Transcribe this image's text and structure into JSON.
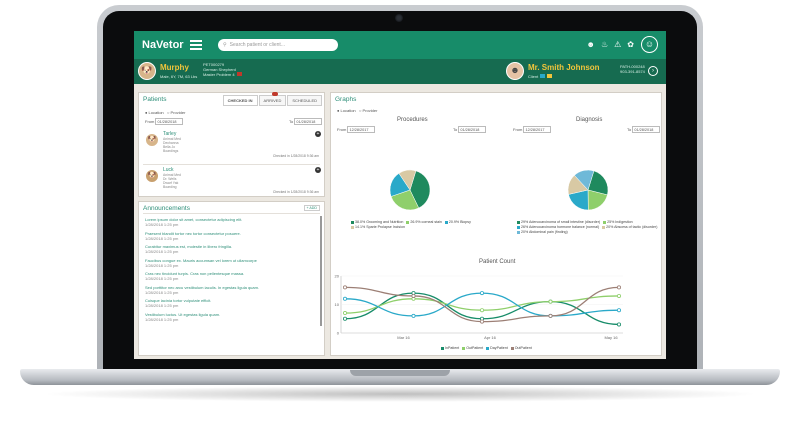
{
  "app": {
    "brand": "NaVetor",
    "search_placeholder": "Search patient or client..."
  },
  "colors": {
    "primary": "#178c69",
    "dark": "#166b50",
    "accent": "#f2c53b",
    "alert": "#c0392b",
    "pie_green": "#1f8a5e",
    "pie_light": "#8fcf6b",
    "pie_teal": "#2aa9c9",
    "pie_sand": "#d8c9a4"
  },
  "header_icons": [
    "user-group-icon",
    "bell-icon",
    "warning-icon",
    "paw-icon"
  ],
  "patient": {
    "name": "Murphy",
    "id": "PET000279",
    "breed": "German Shepherd",
    "problem": "Master Problem 4",
    "details": "Male, 6Y, 7M, 63 Lbs"
  },
  "client": {
    "name": "Mr. Smith Johnson",
    "id": "PATH-000248",
    "phone": "903-391-8574",
    "label": "Client"
  },
  "patients_panel": {
    "title": "Patients",
    "tabs": [
      {
        "label": "CHECKED IN",
        "active": true
      },
      {
        "label": "ARRIVED",
        "active": false
      },
      {
        "label": "SCHEDULED",
        "active": false
      }
    ],
    "filters": {
      "location": "Location",
      "provider": "Provider",
      "from_label": "From",
      "from": "01/28/2018",
      "to_label": "To",
      "to": "01/28/2018"
    },
    "items": [
      {
        "name": "Tarley",
        "lines": [
          "Animal Med",
          "Dechanna",
          "Bella Jo",
          "Boardings"
        ],
        "checked": "Checked in  1/28/2018 9:36 am"
      },
      {
        "name": "Luck",
        "lines": [
          "Animal Med",
          "Dr. Wells",
          "Dwarf Yak",
          "Boarding"
        ],
        "checked": "Checked in  1/28/2018 9:36 am"
      }
    ]
  },
  "announcements": {
    "title": "Announcements",
    "add_label": "+ ADD",
    "items": [
      {
        "text": "Lorem ipsum dolor sit amet, consectetur adipiscing elit.",
        "date": "1/28/2018 1:25 pm"
      },
      {
        "text": "Praesent blandit tortor nec tortor consectetur posuere.",
        "date": "1/28/2018 1:25 pm"
      },
      {
        "text": "Curabitur maximus est, molestie in libero fringilla.",
        "date": "1/28/2018 1:25 pm"
      },
      {
        "text": "Faucibus congue ex. Mauris accumsan vel lorem ut ullamcorpe",
        "date": "1/28/2018 1:25 pm"
      },
      {
        "text": "Cras nec tincidunt turpis. Cras non pellentesque massa.",
        "date": "1/28/2018 1:25 pm"
      },
      {
        "text": "Sed porttitor nec arcu vestibulum iaculis. In egestas ligula quam.",
        "date": "1/28/2018 1:25 pm"
      },
      {
        "text": "Cuisque lacinia tortor vulputate efficit.",
        "date": "1/28/2018 1:25 pm"
      },
      {
        "text": "Vestibulum luctus. Ut egestas ligula quam.",
        "date": "1/28/2018 1:25 pm"
      }
    ]
  },
  "graphs": {
    "title": "Graphs",
    "location": "Location",
    "provider": "Provider",
    "procedures": {
      "title": "Procedures",
      "from_label": "From",
      "from": "12/28/2017",
      "to_label": "To",
      "to": "01/28/2018",
      "legend": [
        "38.0% Grooming and Nutrition",
        "26.9% corneal stain",
        "20.9% Biopsy",
        "14.1% Sparie Prolapse Incision"
      ]
    },
    "diagnosis": {
      "title": "Diagnosis",
      "from_label": "From",
      "from": "12/28/2017",
      "to_label": "To",
      "to": "01/28/2018",
      "legend": [
        "29% Adenocarcinoma of small intestine (disorder)",
        "25% Indigestion",
        "26% Adenocarcinoma hormone balance (normal)",
        "20% Abscess of tactic (disorder)",
        "20% Abdominal pain (finding)"
      ]
    },
    "patient_count": {
      "title": "Patient Count",
      "y_ticks": [
        "20",
        "10",
        "0"
      ],
      "x_ticks": [
        "Mar 16",
        "Apr 16",
        "May 16"
      ],
      "legend": [
        "InPatient",
        "OutPatient",
        "DayPatient",
        "OutPatient"
      ]
    }
  },
  "chart_data": [
    {
      "type": "pie",
      "title": "Procedures",
      "labels": [
        "Grooming and Nutrition",
        "corneal stain",
        "Biopsy",
        "Sparie Prolapse Incision"
      ],
      "values": [
        38.0,
        26.9,
        20.9,
        14.1
      ],
      "colors": [
        "#1f8a5e",
        "#8fcf6b",
        "#2aa9c9",
        "#d8c9a4"
      ]
    },
    {
      "type": "pie",
      "title": "Diagnosis",
      "labels": [
        "Adenocarcinoma of small intestine",
        "Indigestion",
        "Adenocarcinoma hormone balance",
        "Abscess of tactic",
        "Abdominal pain"
      ],
      "values": [
        29,
        25,
        26,
        20,
        20
      ],
      "colors": [
        "#1f8a5e",
        "#8fcf6b",
        "#2aa9c9",
        "#d8c9a4",
        "#6fb9d8"
      ]
    },
    {
      "type": "line",
      "title": "Patient Count",
      "x": [
        "Mar 16",
        "Apr 16",
        "May 16"
      ],
      "ylim": [
        0,
        20
      ],
      "series": [
        {
          "name": "InPatient",
          "color": "#178c69",
          "values": [
            5,
            14,
            5,
            11,
            3
          ]
        },
        {
          "name": "OutPatient",
          "color": "#8fcf6b",
          "values": [
            7,
            12,
            8,
            11,
            13
          ]
        },
        {
          "name": "DayPatient",
          "color": "#2aa9c9",
          "values": [
            12,
            6,
            14,
            6,
            8
          ]
        },
        {
          "name": "OutPatient",
          "color": "#9c7f75",
          "values": [
            16,
            13,
            4,
            6,
            16
          ]
        }
      ]
    }
  ]
}
